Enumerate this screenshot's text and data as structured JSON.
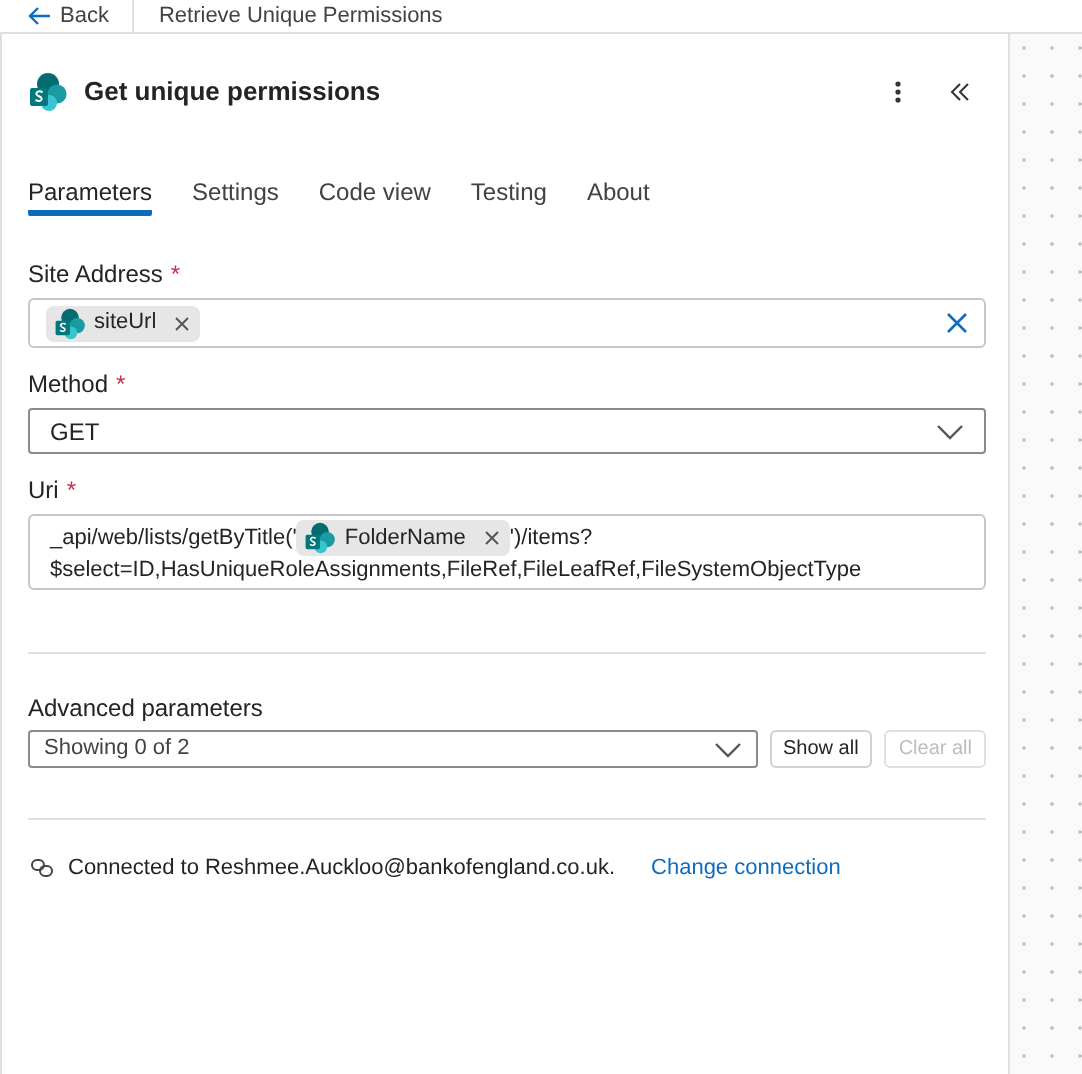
{
  "top_bar": {
    "back": "Back",
    "title": "Retrieve Unique Permissions"
  },
  "action": {
    "title": "Get unique permissions"
  },
  "tabs": [
    {
      "label": "Parameters",
      "selected": true
    },
    {
      "label": "Settings",
      "selected": false
    },
    {
      "label": "Code view",
      "selected": false
    },
    {
      "label": "Testing",
      "selected": false
    },
    {
      "label": "About",
      "selected": false
    }
  ],
  "site_address": {
    "label": "Site Address",
    "marker": "*",
    "token": "siteUrl"
  },
  "method": {
    "label": "Method",
    "marker": "*",
    "value": "GET"
  },
  "uri": {
    "label": "Uri",
    "marker": "*",
    "lines": [
      [
        {
          "kind": "text",
          "text": "_api/web/lists/getByTitle('"
        },
        {
          "kind": "token",
          "text": "FolderName"
        },
        {
          "kind": "text",
          "text": "')/items?"
        }
      ],
      [
        {
          "kind": "text",
          "text": "$select=ID,HasUniqueRoleAssignments,FileRef,FileLeafRef,FileSystemObjectType"
        }
      ]
    ]
  },
  "advanced": {
    "label": "Advanced parameters",
    "value": "Showing 0 of 2",
    "buttons": [
      {
        "label": "Show all",
        "disabled": false
      },
      {
        "label": "Clear all",
        "disabled": true
      }
    ]
  },
  "connection": {
    "text": "Connected to Reshmee.Auckloo@bankofengland.co.uk.",
    "link": "Change connection"
  }
}
